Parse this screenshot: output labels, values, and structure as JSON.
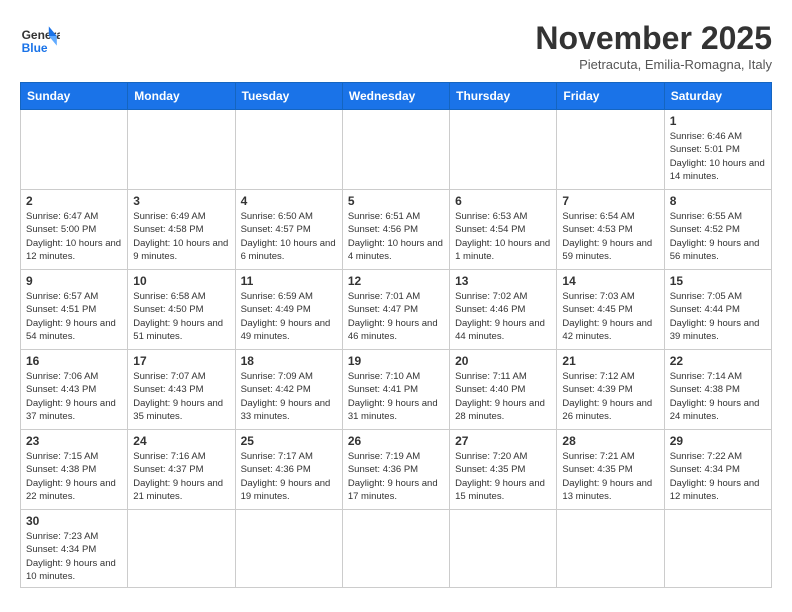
{
  "header": {
    "logo_general": "General",
    "logo_blue": "Blue",
    "month_title": "November 2025",
    "subtitle": "Pietracuta, Emilia-Romagna, Italy"
  },
  "weekdays": [
    "Sunday",
    "Monday",
    "Tuesday",
    "Wednesday",
    "Thursday",
    "Friday",
    "Saturday"
  ],
  "weeks": [
    [
      {
        "day": "",
        "info": ""
      },
      {
        "day": "",
        "info": ""
      },
      {
        "day": "",
        "info": ""
      },
      {
        "day": "",
        "info": ""
      },
      {
        "day": "",
        "info": ""
      },
      {
        "day": "",
        "info": ""
      },
      {
        "day": "1",
        "info": "Sunrise: 6:46 AM\nSunset: 5:01 PM\nDaylight: 10 hours and 14 minutes."
      }
    ],
    [
      {
        "day": "2",
        "info": "Sunrise: 6:47 AM\nSunset: 5:00 PM\nDaylight: 10 hours and 12 minutes."
      },
      {
        "day": "3",
        "info": "Sunrise: 6:49 AM\nSunset: 4:58 PM\nDaylight: 10 hours and 9 minutes."
      },
      {
        "day": "4",
        "info": "Sunrise: 6:50 AM\nSunset: 4:57 PM\nDaylight: 10 hours and 6 minutes."
      },
      {
        "day": "5",
        "info": "Sunrise: 6:51 AM\nSunset: 4:56 PM\nDaylight: 10 hours and 4 minutes."
      },
      {
        "day": "6",
        "info": "Sunrise: 6:53 AM\nSunset: 4:54 PM\nDaylight: 10 hours and 1 minute."
      },
      {
        "day": "7",
        "info": "Sunrise: 6:54 AM\nSunset: 4:53 PM\nDaylight: 9 hours and 59 minutes."
      },
      {
        "day": "8",
        "info": "Sunrise: 6:55 AM\nSunset: 4:52 PM\nDaylight: 9 hours and 56 minutes."
      }
    ],
    [
      {
        "day": "9",
        "info": "Sunrise: 6:57 AM\nSunset: 4:51 PM\nDaylight: 9 hours and 54 minutes."
      },
      {
        "day": "10",
        "info": "Sunrise: 6:58 AM\nSunset: 4:50 PM\nDaylight: 9 hours and 51 minutes."
      },
      {
        "day": "11",
        "info": "Sunrise: 6:59 AM\nSunset: 4:49 PM\nDaylight: 9 hours and 49 minutes."
      },
      {
        "day": "12",
        "info": "Sunrise: 7:01 AM\nSunset: 4:47 PM\nDaylight: 9 hours and 46 minutes."
      },
      {
        "day": "13",
        "info": "Sunrise: 7:02 AM\nSunset: 4:46 PM\nDaylight: 9 hours and 44 minutes."
      },
      {
        "day": "14",
        "info": "Sunrise: 7:03 AM\nSunset: 4:45 PM\nDaylight: 9 hours and 42 minutes."
      },
      {
        "day": "15",
        "info": "Sunrise: 7:05 AM\nSunset: 4:44 PM\nDaylight: 9 hours and 39 minutes."
      }
    ],
    [
      {
        "day": "16",
        "info": "Sunrise: 7:06 AM\nSunset: 4:43 PM\nDaylight: 9 hours and 37 minutes."
      },
      {
        "day": "17",
        "info": "Sunrise: 7:07 AM\nSunset: 4:43 PM\nDaylight: 9 hours and 35 minutes."
      },
      {
        "day": "18",
        "info": "Sunrise: 7:09 AM\nSunset: 4:42 PM\nDaylight: 9 hours and 33 minutes."
      },
      {
        "day": "19",
        "info": "Sunrise: 7:10 AM\nSunset: 4:41 PM\nDaylight: 9 hours and 31 minutes."
      },
      {
        "day": "20",
        "info": "Sunrise: 7:11 AM\nSunset: 4:40 PM\nDaylight: 9 hours and 28 minutes."
      },
      {
        "day": "21",
        "info": "Sunrise: 7:12 AM\nSunset: 4:39 PM\nDaylight: 9 hours and 26 minutes."
      },
      {
        "day": "22",
        "info": "Sunrise: 7:14 AM\nSunset: 4:38 PM\nDaylight: 9 hours and 24 minutes."
      }
    ],
    [
      {
        "day": "23",
        "info": "Sunrise: 7:15 AM\nSunset: 4:38 PM\nDaylight: 9 hours and 22 minutes."
      },
      {
        "day": "24",
        "info": "Sunrise: 7:16 AM\nSunset: 4:37 PM\nDaylight: 9 hours and 21 minutes."
      },
      {
        "day": "25",
        "info": "Sunrise: 7:17 AM\nSunset: 4:36 PM\nDaylight: 9 hours and 19 minutes."
      },
      {
        "day": "26",
        "info": "Sunrise: 7:19 AM\nSunset: 4:36 PM\nDaylight: 9 hours and 17 minutes."
      },
      {
        "day": "27",
        "info": "Sunrise: 7:20 AM\nSunset: 4:35 PM\nDaylight: 9 hours and 15 minutes."
      },
      {
        "day": "28",
        "info": "Sunrise: 7:21 AM\nSunset: 4:35 PM\nDaylight: 9 hours and 13 minutes."
      },
      {
        "day": "29",
        "info": "Sunrise: 7:22 AM\nSunset: 4:34 PM\nDaylight: 9 hours and 12 minutes."
      }
    ],
    [
      {
        "day": "30",
        "info": "Sunrise: 7:23 AM\nSunset: 4:34 PM\nDaylight: 9 hours and 10 minutes."
      },
      {
        "day": "",
        "info": ""
      },
      {
        "day": "",
        "info": ""
      },
      {
        "day": "",
        "info": ""
      },
      {
        "day": "",
        "info": ""
      },
      {
        "day": "",
        "info": ""
      },
      {
        "day": "",
        "info": ""
      }
    ]
  ]
}
